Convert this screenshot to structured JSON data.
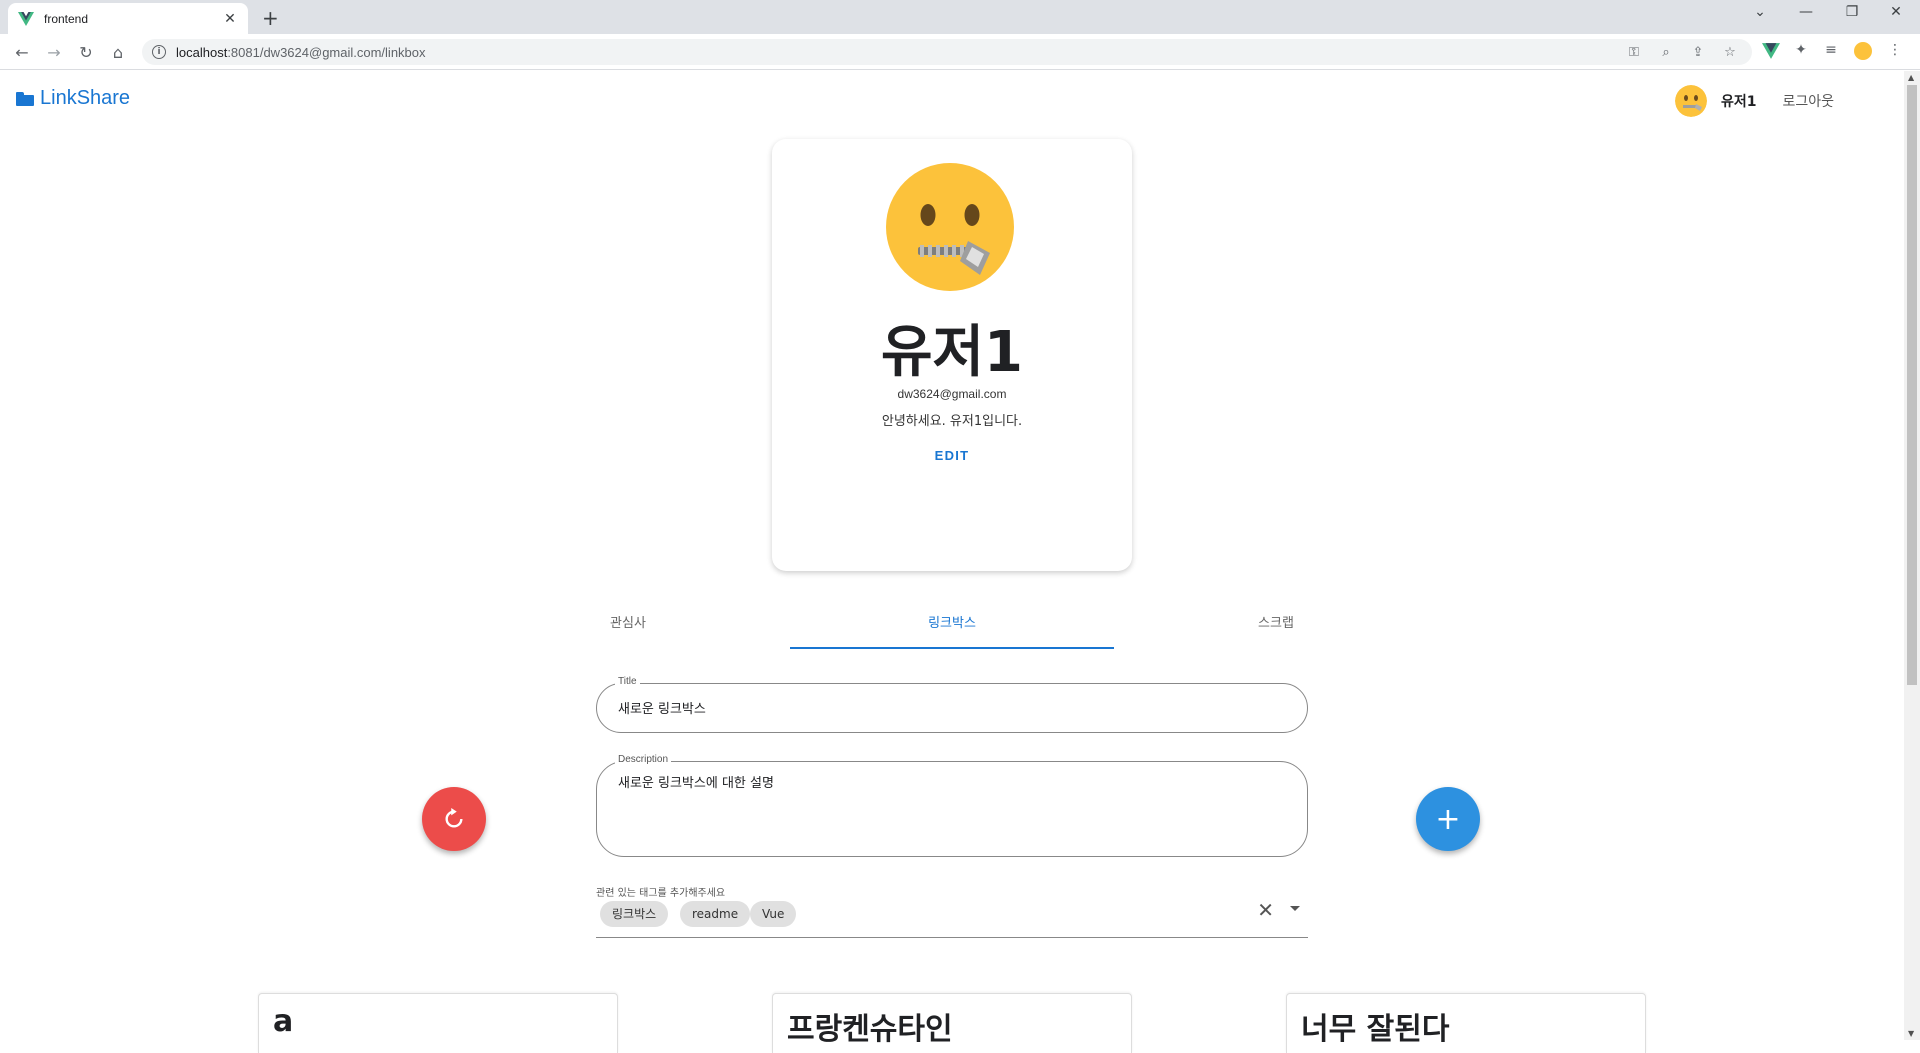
{
  "browser": {
    "tab_title": "frontend",
    "url_host": "localhost",
    "url_rest": ":8081/dw3624@gmail.com/linkbox",
    "accent": "#1a73e8"
  },
  "app": {
    "brand": "LinkShare",
    "brand_color": "#1976d2",
    "user_name": "유저1",
    "logout_label": "로그아웃"
  },
  "profile": {
    "avatar_icon": "zipper-mouth-face-emoji",
    "name": "유저1",
    "email": "dw3624@gmail.com",
    "bio": "안녕하세요. 유저1입니다.",
    "edit_label": "EDIT"
  },
  "tabs": [
    {
      "label": "관심사",
      "active": false
    },
    {
      "label": "링크박스",
      "active": true
    },
    {
      "label": "스크랩",
      "active": false
    }
  ],
  "form": {
    "title_label": "Title",
    "title_value": "새로운 링크박스",
    "description_label": "Description",
    "description_value": "새로운 링크박스에 대한 설명",
    "tags_hint": "관련 있는 태그를 추가해주세요",
    "tags": [
      "링크박스",
      "readme",
      "Vue"
    ]
  },
  "actions": {
    "reset_icon": "refresh-icon",
    "reset_color": "#ec4c4a",
    "add_icon": "plus-icon",
    "add_color": "#2d91e0"
  },
  "linkboxes": [
    {
      "title": "a"
    },
    {
      "title": "프랑켄슈타인"
    },
    {
      "title": "너무 잘된다"
    }
  ]
}
